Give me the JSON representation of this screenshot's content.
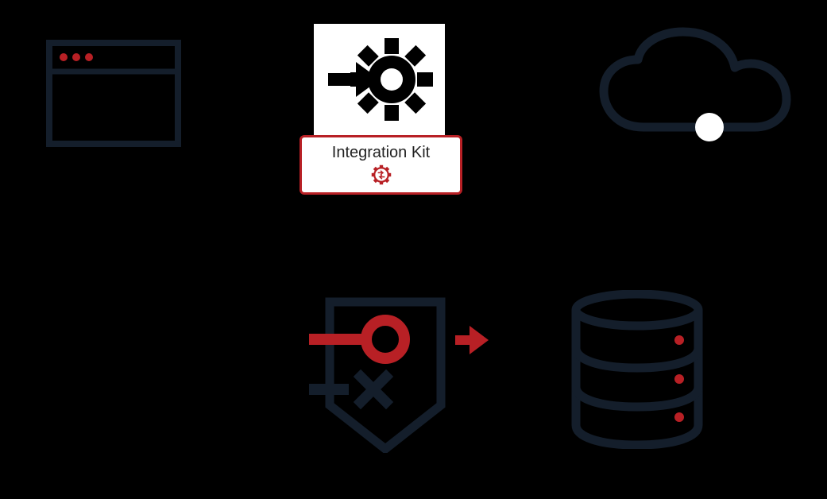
{
  "diagram": {
    "integration_kit_label": "Integration Kit",
    "colors": {
      "dark": "#141e2b",
      "red": "#b82025",
      "white": "#ffffff"
    },
    "icons": {
      "browser": "browser-window-icon",
      "gear_arrow": "gear-arrow-icon",
      "integration_gear": "integration-gear-icon",
      "cloud": "cloud-icon",
      "firewall": "firewall-access-icon",
      "database": "database-icon"
    }
  }
}
